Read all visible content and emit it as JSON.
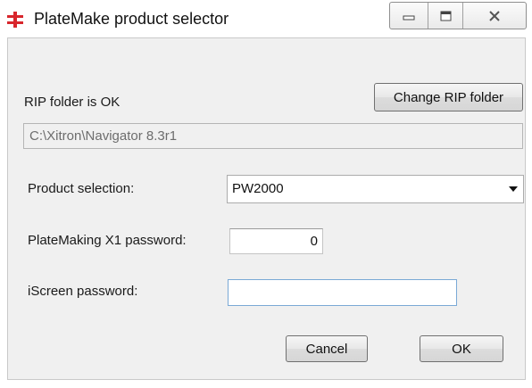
{
  "window": {
    "title": "PlateMake product selector",
    "accent_color": "#d8262c",
    "buttons": {
      "minimize": "minimize",
      "maximize": "maximize",
      "close": "close"
    }
  },
  "rip": {
    "status": "RIP folder is OK",
    "change_button": "Change RIP folder",
    "path": "C:\\Xitron\\Navigator 8.3r1"
  },
  "product": {
    "label": "Product selection:",
    "selected": "PW2000"
  },
  "platemaking": {
    "label": "PlateMaking X1 password:",
    "value": "0"
  },
  "iscreen": {
    "label": "iScreen password:",
    "value": ""
  },
  "actions": {
    "cancel": "Cancel",
    "ok": "OK"
  }
}
